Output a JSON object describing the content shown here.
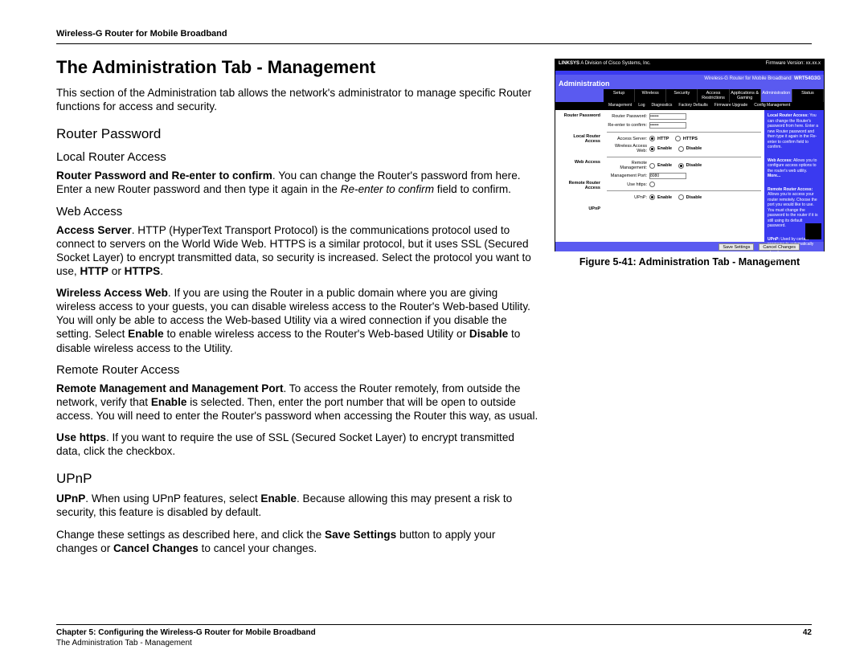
{
  "header": "Wireless-G Router for Mobile Broadband",
  "title": "The Administration Tab - Management",
  "intro": "This section of the Administration tab allows the network's administrator to manage specific Router functions for access and security.",
  "s_router_password": "Router Password",
  "s_local": "Local Router Access",
  "p_local_a": "Router Password and Re-enter to confirm",
  "p_local_b": ". You can change the Router's password from here. Enter a new Router password and then type it again in the ",
  "p_local_i": "Re-enter to confirm",
  "p_local_c": " field to confirm.",
  "s_web": "Web Access",
  "p_web1_a": "Access Server",
  "p_web1_b": ". HTTP (HyperText Transport Protocol) is the communications protocol used to connect to servers on the World Wide Web. HTTPS is a similar protocol, but it uses SSL (Secured Socket Layer) to encrypt transmitted data, so security is increased. Select the protocol you want to use, ",
  "p_web1_h1": "HTTP",
  "p_web1_or": " or ",
  "p_web1_h2": "HTTPS",
  "p_web1_end": ".",
  "p_web2_a": "Wireless Access Web",
  "p_web2_b": ". If you are using the Router in a public domain where you are giving wireless access to your guests, you can disable wireless access to the Router's Web-based Utility. You will only be able to access the Web-based Utility via a wired connection if you disable the setting. Select ",
  "p_web2_en": "Enable",
  "p_web2_c": " to enable wireless access to the Router's Web-based Utility or ",
  "p_web2_dis": "Disable",
  "p_web2_d": " to disable wireless access to the Utility.",
  "s_remote": "Remote Router Access",
  "p_rem1_a": "Remote Management and Management Port",
  "p_rem1_b": ". To access the Router remotely, from outside the network, verify that ",
  "p_rem1_en": "Enable",
  "p_rem1_c": " is selected. Then, enter the port number that will be open to outside access. You will need to enter the Router's password when accessing the Router this way, as usual.",
  "p_rem2_a": "Use https",
  "p_rem2_b": ". If you want to require the use of SSL (Secured Socket Layer) to encrypt transmitted data, click the checkbox.",
  "s_upnp": "UPnP",
  "p_upnp_a": "UPnP",
  "p_upnp_b": ". When using UPnP features, select ",
  "p_upnp_en": "Enable",
  "p_upnp_c": ". Because allowing this may present a risk to security, this feature is disabled by default.",
  "p_save_a": "Change these settings as described here, and click the ",
  "p_save_b1": "Save Settings",
  "p_save_c": " button to apply your changes or ",
  "p_save_b2": "Cancel Changes",
  "p_save_d": " to cancel your changes.",
  "figure_caption": "Figure 5-41: Administration Tab - Management",
  "router": {
    "brand": "LINKSYS",
    "brand_sub": "A Division of Cisco Systems, Inc.",
    "product": "Wireless-G Router for Mobile Broadband",
    "model": "WRT54G3G",
    "firmware": "Firmware Version: xx.xx.x",
    "section": "Administration",
    "tabs": [
      "Setup",
      "Wireless",
      "Security",
      "Access Restrictions",
      "Applications & Gaming",
      "Administration",
      "Status"
    ],
    "subtabs": [
      "Management",
      "Log",
      "Diagnostics",
      "Factory Defaults",
      "Firmware Upgrade",
      "Config Management"
    ],
    "left_labels": [
      "Router Password",
      "Local Router Access",
      "Web Access",
      "Remote Router Access",
      "UPnP"
    ],
    "fields": {
      "password_label": "Router Password:",
      "confirm_label": "Re-enter to confirm:",
      "access_server_label": "Access Server:",
      "http": "HTTP",
      "https": "HTTPS",
      "wireless_web_label": "Wireless Access Web:",
      "enable": "Enable",
      "disable": "Disable",
      "remote_mgmt_label": "Remote Management:",
      "mgmt_port_label": "Management Port:",
      "mgmt_port_value": "8080",
      "use_https_label": "Use https:",
      "upnp_label": "UPnP:"
    },
    "help": {
      "h1": "Local Router Access:",
      "t1": "You can change the Router's password from here. Enter a new Router password and then type it again in the Re-enter to confirm field to confirm.",
      "h2": "Web Access:",
      "t2": "Allows you to configure access options to the router's web utility.",
      "more": "More...",
      "h3": "Remote Router Access:",
      "t3": "Allows you to access your router remotely. Choose the port you would like to use. You must change the password to the router if it is still using its default password.",
      "h4": "UPnP:",
      "t4": "Used by certain programs to automatically open ports for communication."
    },
    "buttons": {
      "save": "Save Settings",
      "cancel": "Cancel Changes"
    }
  },
  "footer": {
    "chapter": "Chapter 5: Configuring the Wireless-G Router for Mobile Broadband",
    "section": "The Administration Tab - Management",
    "page": "42"
  }
}
